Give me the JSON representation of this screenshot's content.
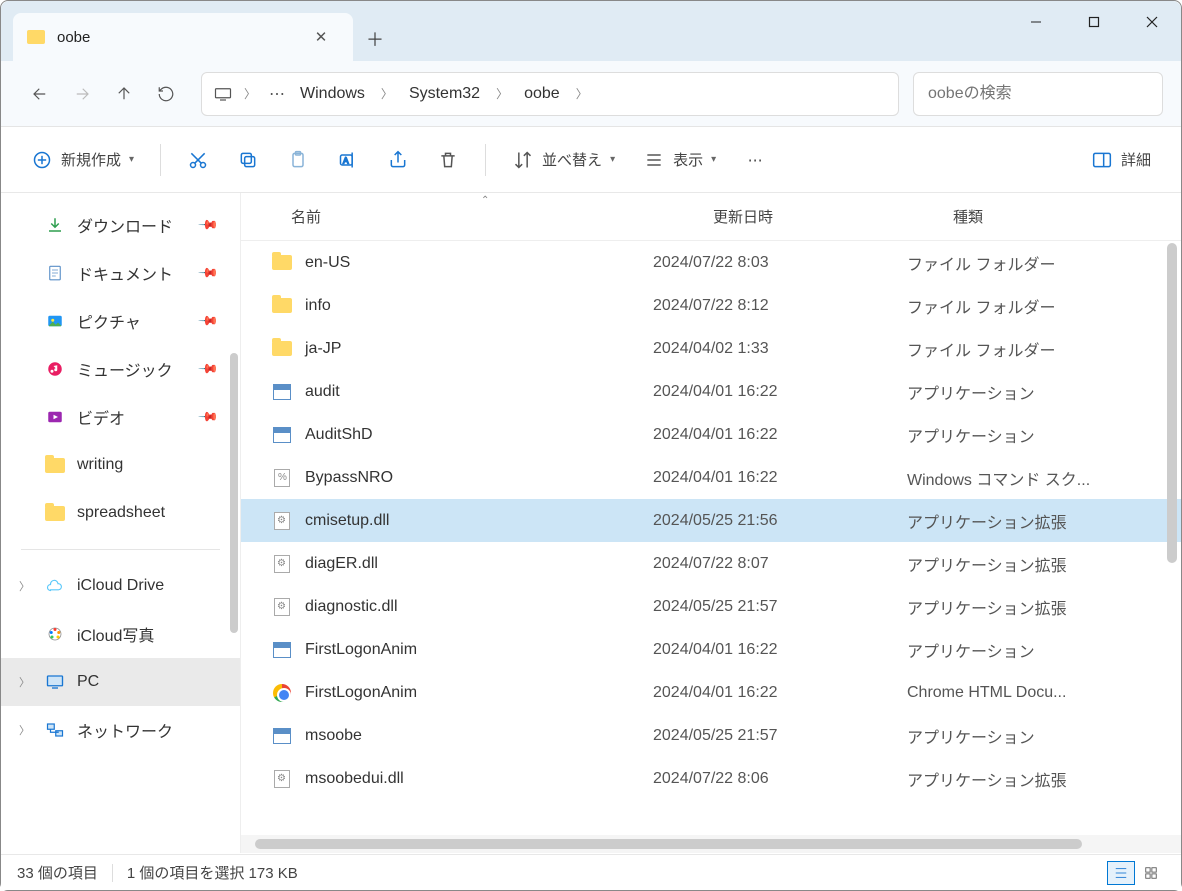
{
  "window": {
    "tab_title": "oobe"
  },
  "breadcrumb": [
    "Windows",
    "System32",
    "oobe"
  ],
  "search": {
    "placeholder": "oobeの検索"
  },
  "toolbar": {
    "new": "新規作成",
    "sort": "並べ替え",
    "view": "表示",
    "details": "詳細"
  },
  "columns": {
    "name": "名前",
    "date": "更新日時",
    "type": "種類"
  },
  "sidebar": {
    "quick": [
      {
        "label": "ダウンロード",
        "icon": "download",
        "pinned": true
      },
      {
        "label": "ドキュメント",
        "icon": "document",
        "pinned": true
      },
      {
        "label": "ピクチャ",
        "icon": "pictures",
        "pinned": true
      },
      {
        "label": "ミュージック",
        "icon": "music",
        "pinned": true
      },
      {
        "label": "ビデオ",
        "icon": "video",
        "pinned": true
      },
      {
        "label": "writing",
        "icon": "folder",
        "pinned": false
      },
      {
        "label": "spreadsheet",
        "icon": "folder",
        "pinned": false
      }
    ],
    "drives": [
      {
        "label": "iCloud Drive",
        "icon": "icloud",
        "expandable": true
      },
      {
        "label": "iCloud写真",
        "icon": "icloud-photos",
        "expandable": false
      },
      {
        "label": "PC",
        "icon": "pc",
        "expandable": true,
        "selected": true
      },
      {
        "label": "ネットワーク",
        "icon": "network",
        "expandable": true
      }
    ]
  },
  "files": [
    {
      "name": "en-US",
      "date": "2024/07/22 8:03",
      "type": "ファイル フォルダー",
      "icon": "folder"
    },
    {
      "name": "info",
      "date": "2024/07/22 8:12",
      "type": "ファイル フォルダー",
      "icon": "folder"
    },
    {
      "name": "ja-JP",
      "date": "2024/04/02 1:33",
      "type": "ファイル フォルダー",
      "icon": "folder"
    },
    {
      "name": "audit",
      "date": "2024/04/01 16:22",
      "type": "アプリケーション",
      "icon": "exe"
    },
    {
      "name": "AuditShD",
      "date": "2024/04/01 16:22",
      "type": "アプリケーション",
      "icon": "exe"
    },
    {
      "name": "BypassNRO",
      "date": "2024/04/01 16:22",
      "type": "Windows コマンド スク...",
      "icon": "cmd"
    },
    {
      "name": "cmisetup.dll",
      "date": "2024/05/25 21:56",
      "type": "アプリケーション拡張",
      "icon": "dll",
      "selected": true
    },
    {
      "name": "diagER.dll",
      "date": "2024/07/22 8:07",
      "type": "アプリケーション拡張",
      "icon": "dll"
    },
    {
      "name": "diagnostic.dll",
      "date": "2024/05/25 21:57",
      "type": "アプリケーション拡張",
      "icon": "dll"
    },
    {
      "name": "FirstLogonAnim",
      "date": "2024/04/01 16:22",
      "type": "アプリケーション",
      "icon": "exe"
    },
    {
      "name": "FirstLogonAnim",
      "date": "2024/04/01 16:22",
      "type": "Chrome HTML Docu...",
      "icon": "chrome"
    },
    {
      "name": "msoobe",
      "date": "2024/05/25 21:57",
      "type": "アプリケーション",
      "icon": "exe"
    },
    {
      "name": "msoobedui.dll",
      "date": "2024/07/22 8:06",
      "type": "アプリケーション拡張",
      "icon": "dll"
    }
  ],
  "status": {
    "item_count": "33 個の項目",
    "selection": "1 個の項目を選択 173 KB"
  }
}
